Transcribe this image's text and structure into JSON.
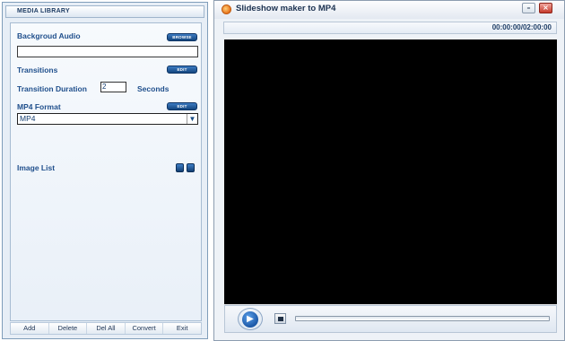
{
  "library": {
    "header": "MEDIA LIBRARY",
    "background_audio_label": "Backgroud Audio",
    "browse_label": "BROWSE",
    "transitions_label": "Transitions",
    "edit_label": "EDIT",
    "duration_label": "Transition Duration",
    "duration_value": "2",
    "seconds_label": "Seconds",
    "format_label": "MP4 Format",
    "format_edit_label": "EDIT",
    "format_selected": "MP4",
    "image_list_label": "Image List"
  },
  "bottom_buttons": [
    "Add",
    "Delete",
    "Del All",
    "Convert",
    "Exit"
  ],
  "window": {
    "title": "Slideshow maker to MP4",
    "minimize": "–",
    "maximize": "□",
    "close": "×"
  },
  "player": {
    "time": "00:00:00/02:00:00",
    "play_icon": "play-icon",
    "stop_icon": "stop-icon",
    "progress": 0
  },
  "colors": {
    "accent": "#1f4f8c",
    "button": "#14467f",
    "video_background": "#000000"
  }
}
